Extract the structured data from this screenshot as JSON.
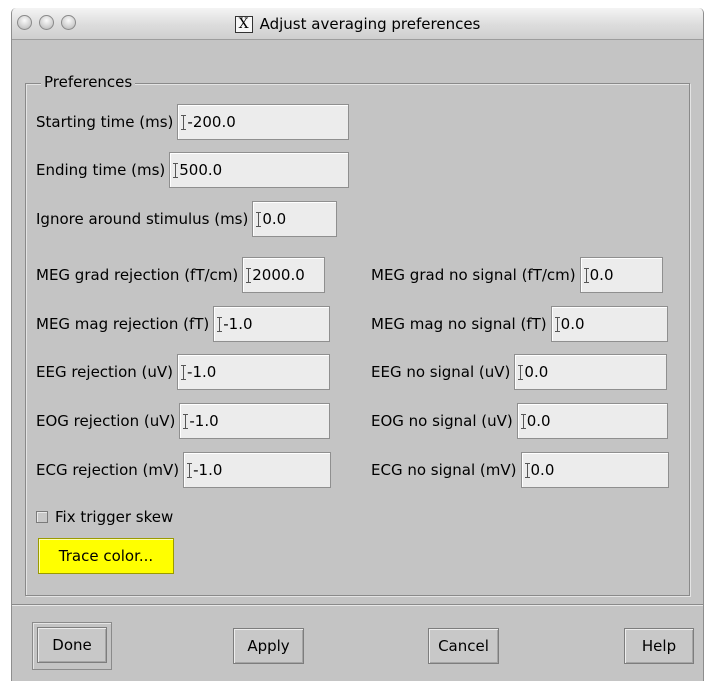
{
  "window": {
    "title": "Adjust averaging preferences",
    "title_icon": "X",
    "traffic_lights": [
      "close",
      "minimize",
      "zoom"
    ]
  },
  "preferences": {
    "legend": "Preferences",
    "starting_time": {
      "label": "Starting time (ms)",
      "value": "-200.0"
    },
    "ending_time": {
      "label": "Ending time (ms)",
      "value": "500.0"
    },
    "ignore_around_stimulus": {
      "label": "Ignore around stimulus (ms)",
      "value": "0.0"
    },
    "rejection": [
      {
        "label": "MEG grad rejection (fT/cm)",
        "value": "2000.0"
      },
      {
        "label": "MEG mag rejection (fT)",
        "value": "-1.0"
      },
      {
        "label": "EEG rejection (uV)",
        "value": "-1.0"
      },
      {
        "label": "EOG rejection (uV)",
        "value": "-1.0"
      },
      {
        "label": "ECG rejection (mV)",
        "value": "-1.0"
      }
    ],
    "no_signal": [
      {
        "label": "MEG grad no signal (fT/cm)",
        "value": "0.0"
      },
      {
        "label": "MEG mag no signal (fT)",
        "value": "0.0"
      },
      {
        "label": "EEG no signal (uV)",
        "value": "0.0"
      },
      {
        "label": "EOG no signal (uV)",
        "value": "0.0"
      },
      {
        "label": "ECG no signal (mV)",
        "value": "0.0"
      }
    ],
    "fix_trigger_skew": {
      "label": "Fix trigger skew",
      "checked": false
    },
    "trace_color_button": "Trace color...",
    "trace_color": "#ffff00"
  },
  "buttons": {
    "done": "Done",
    "apply": "Apply",
    "cancel": "Cancel",
    "help": "Help"
  }
}
